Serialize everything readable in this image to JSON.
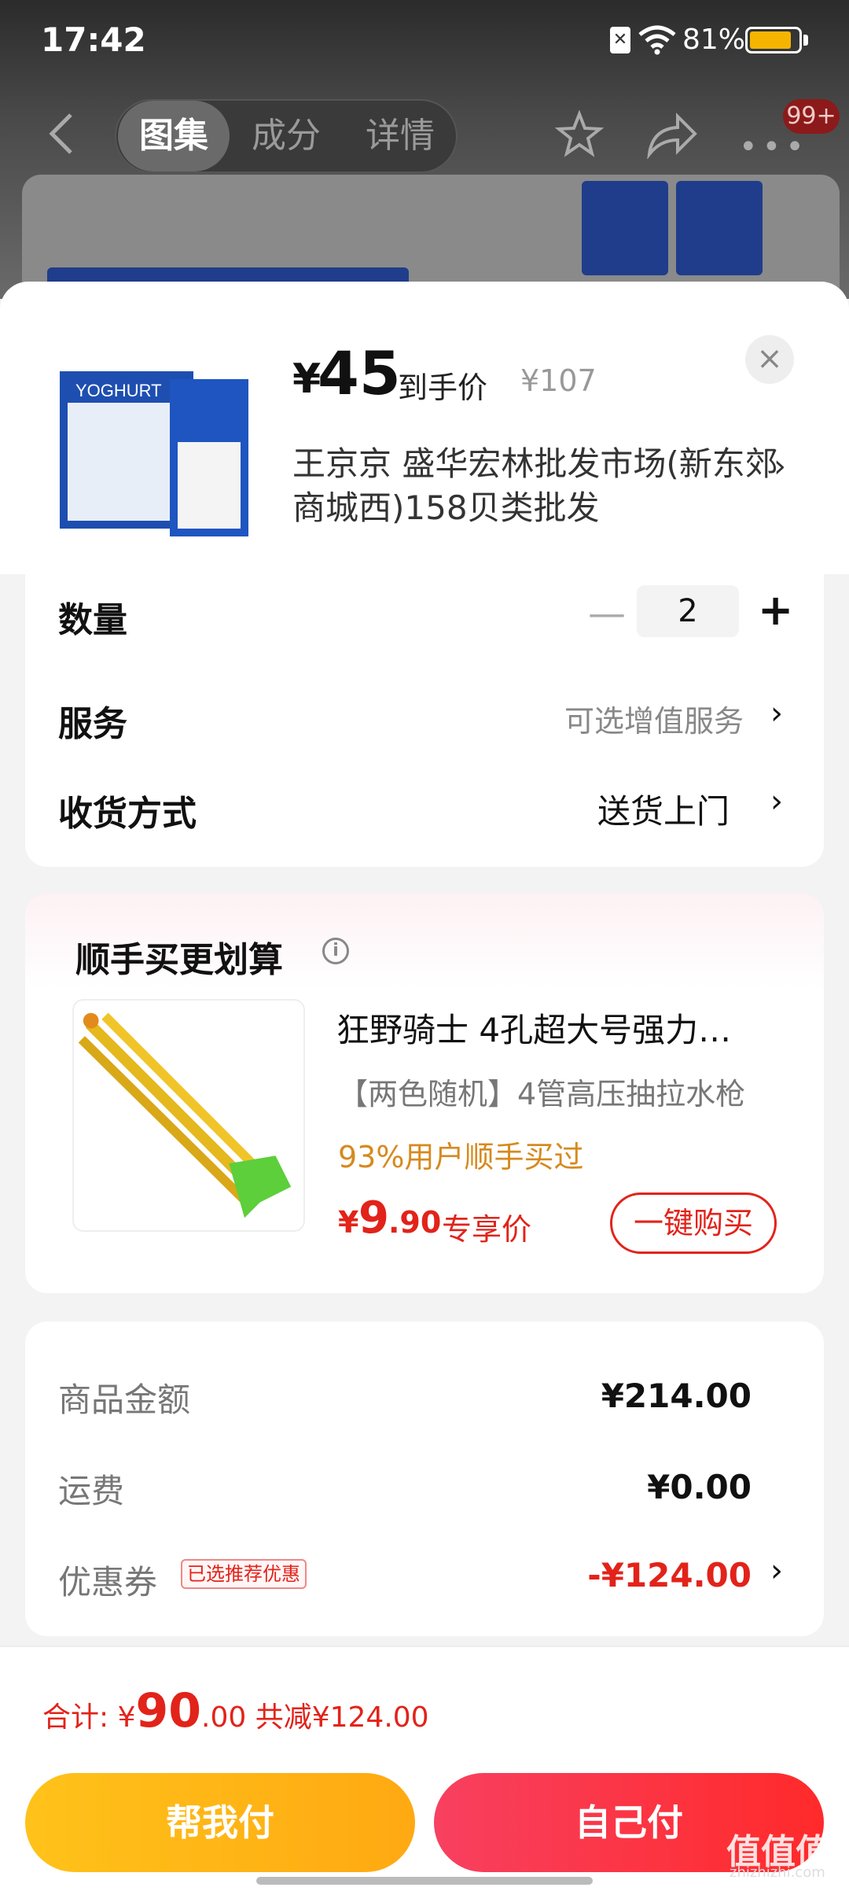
{
  "status_bar": {
    "time": "17:42",
    "battery": "81%"
  },
  "top_nav": {
    "tabs": [
      {
        "label": "图集",
        "active": true
      },
      {
        "label": "成分"
      },
      {
        "label": "详情"
      }
    ],
    "more_badge": "99+"
  },
  "product": {
    "price_symbol": "¥",
    "price": "45",
    "price_label": "到手价",
    "original_price": "¥107",
    "store": "王京京  盛华宏林批发市场(新东郊商城西)158贝类批发"
  },
  "options": {
    "quantity_label": "数量",
    "quantity_value": "2",
    "service_label": "服务",
    "service_value": "可选增值服务",
    "delivery_label": "收货方式",
    "delivery_value": "送货上门"
  },
  "recommend": {
    "title": "顺手买更划算",
    "item_title": "狂野骑士 4孔超大号强力…",
    "item_sub": "【两色随机】4管高压抽拉水枪",
    "item_stat": "93%用户顺手买过",
    "price_symbol": "¥",
    "price_int": "9",
    "price_dec": ".90",
    "price_tag": "专享价",
    "buy_label": "一键购买"
  },
  "summary": {
    "goods_label": "商品金额",
    "goods_value": "¥214.00",
    "shipping_label": "运费",
    "shipping_value": "¥0.00",
    "coupon_label": "优惠券",
    "coupon_tag": "已选推荐优惠",
    "coupon_value": "-¥124.00"
  },
  "footer": {
    "total_label": "合计:",
    "total_symbol": "¥",
    "total_int": "90",
    "total_dec": ".00",
    "total_saved": "共减¥124.00",
    "help_pay": "帮我付",
    "self_pay": "自己付"
  },
  "watermark": {
    "text": "值值值",
    "sub": "zhizhizhi.com"
  },
  "colors": {
    "accent_red": "#e2231a",
    "accent_yellow": "#ffc21a",
    "stat_orange": "#d68a1e"
  }
}
